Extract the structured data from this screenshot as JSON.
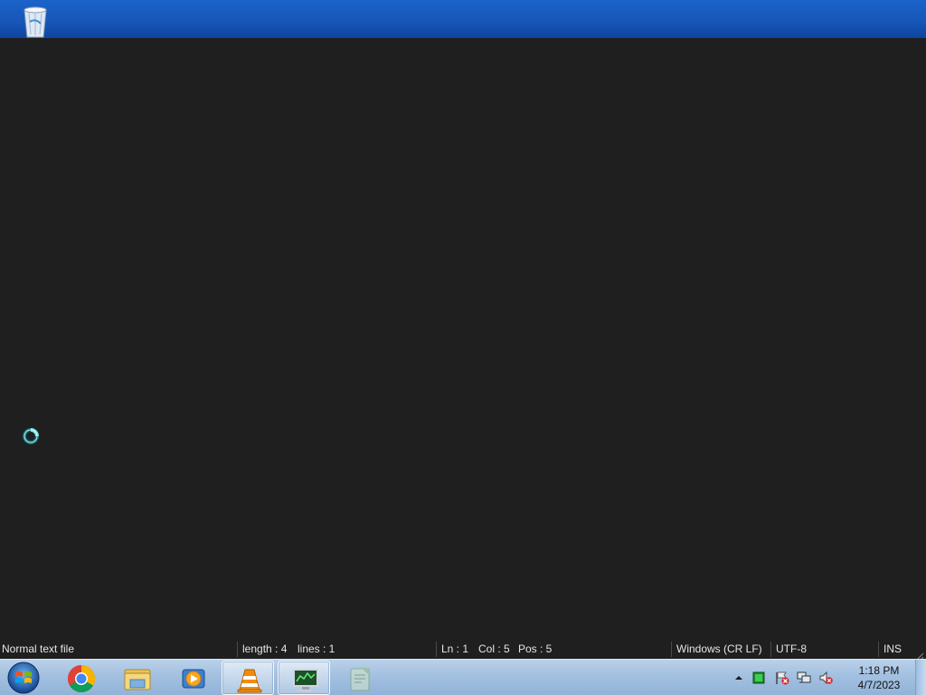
{
  "desktop": {
    "icons": [
      {
        "name": "recycle-bin-icon"
      }
    ]
  },
  "statusbar": {
    "file_type": "Normal text file",
    "length": "length : 4",
    "lines": "lines : 1",
    "ln": "Ln : 1",
    "col": "Col : 5",
    "pos": "Pos : 5",
    "eol": "Windows (CR LF)",
    "encoding": "UTF-8",
    "mode": "INS"
  },
  "taskbar": {
    "pinned": [
      {
        "icon": "chrome-icon"
      },
      {
        "icon": "file-explorer-icon"
      },
      {
        "icon": "media-player-icon"
      },
      {
        "icon": "vlc-icon"
      },
      {
        "icon": "system-monitor-icon"
      },
      {
        "icon": "notepad-plus-plus-icon"
      }
    ],
    "tray": {
      "icons": [
        "show-hidden-icons-arrow",
        "green-app-icon",
        "action-center-flag-icon",
        "network-icon",
        "volume-muted-icon"
      ],
      "time": "1:18 PM",
      "date": "4/7/2023"
    }
  },
  "colors": {
    "editor_bg": "#1f1f1f",
    "status_text": "#e6e6e6",
    "taskbar_top": "#b9d1ea",
    "desktop_blue": "#1a63c9"
  }
}
